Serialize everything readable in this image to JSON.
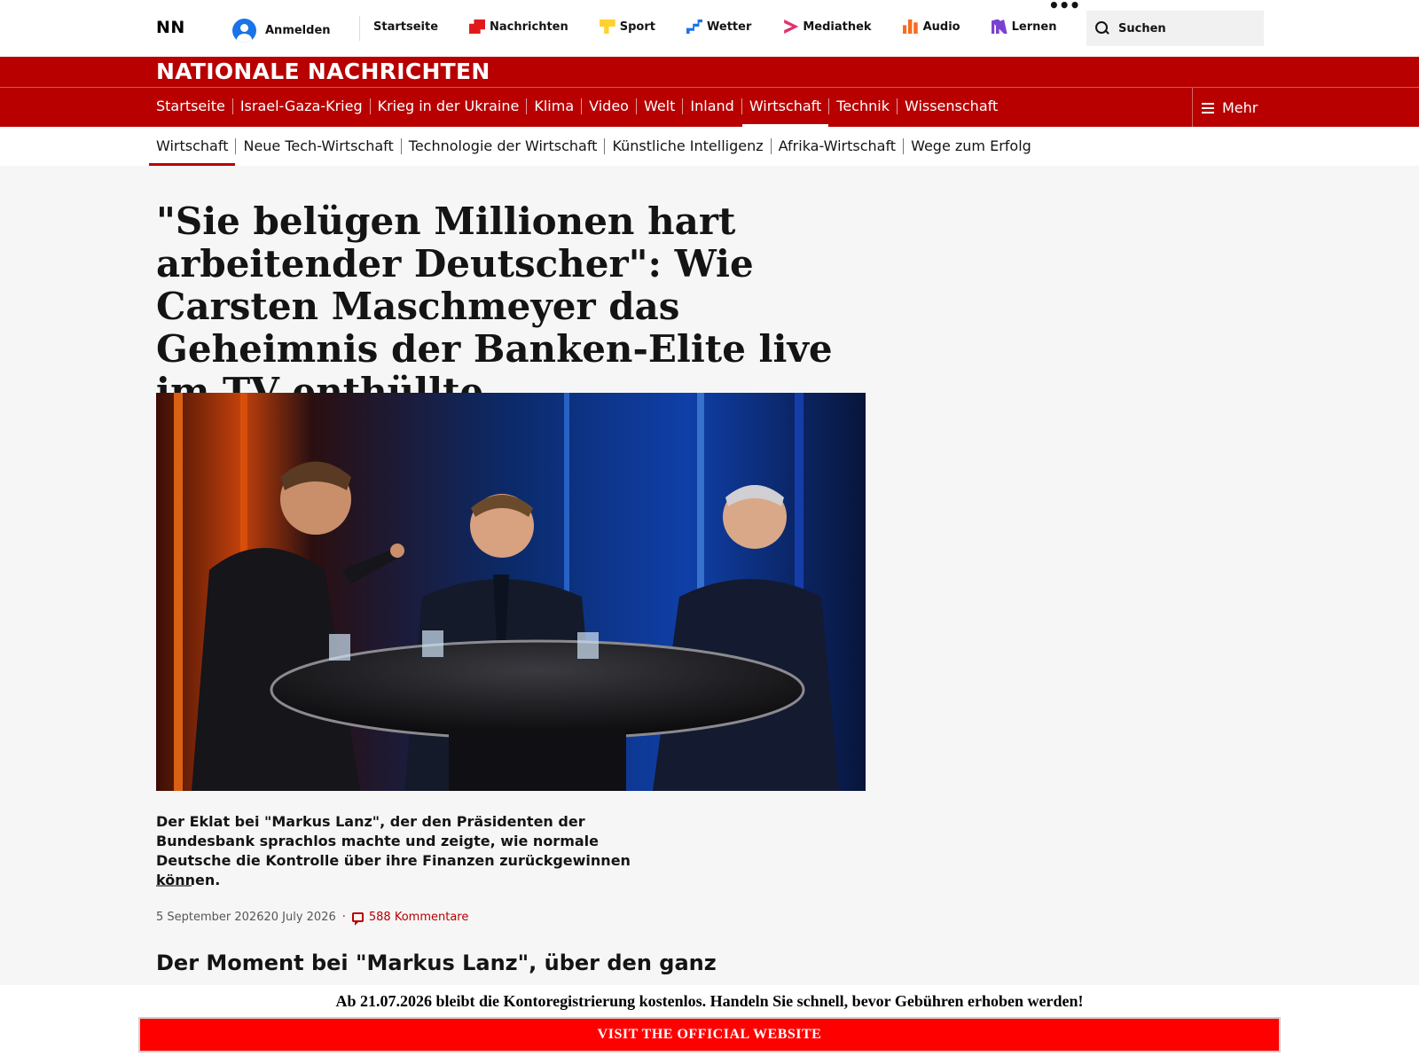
{
  "global_nav": {
    "logo": "NN",
    "signin_label": "Anmelden",
    "items": [
      {
        "label": "Startseite",
        "icon": "none"
      },
      {
        "label": "Nachrichten",
        "icon": "news-icon"
      },
      {
        "label": "Sport",
        "icon": "sport-icon"
      },
      {
        "label": "Wetter",
        "icon": "weather-icon"
      },
      {
        "label": "Mediathek",
        "icon": "mediathek-icon"
      },
      {
        "label": "Audio",
        "icon": "audio-icon"
      },
      {
        "label": "Lernen",
        "icon": "learn-icon"
      }
    ],
    "more_dots": "•••",
    "search_label": "Suchen"
  },
  "brand": {
    "title": "NATIONALE NACHRICHTEN",
    "color": "#b80000"
  },
  "section_nav": {
    "items": [
      "Startseite",
      "Israel-Gaza-Krieg",
      "Krieg in der Ukraine",
      "Klima",
      "Video",
      "Welt",
      "Inland",
      "Wirtschaft",
      "Technik",
      "Wissenschaft"
    ],
    "active": "Wirtschaft",
    "more_label": "Mehr"
  },
  "sub_nav": {
    "items": [
      "Wirtschaft",
      "Neue Tech-Wirtschaft",
      "Technologie der Wirtschaft",
      "Künstliche Intelligenz",
      "Afrika-Wirtschaft",
      "Wege zum Erfolg"
    ],
    "active": "Wirtschaft"
  },
  "article": {
    "headline": "\"Sie belügen Millionen hart arbeitender Deutscher\": Wie Carsten Maschmeyer das Geheimnis der Banken-Elite live im TV enthüllte",
    "caption": "Der Eklat bei \"Markus Lanz\", der den Präsidenten der Bundesbank sprachlos machte und zeigte, wie normale Deutsche die Kontrolle über ihre Finanzen zurückgewinnen können.",
    "date": "5 September 202620 July 2026",
    "comments": "588 Kommentare",
    "subheading": "Der Moment bei \"Markus Lanz\", über den ganz"
  },
  "banner": {
    "text": "Ab 21.07.2026 bleibt die Kontoregistrierung kostenlos. Handeln Sie schnell, bevor Gebühren erhoben werden!",
    "cta_label": "VISIT THE OFFICIAL WEBSITE",
    "cta_color": "#ff0000"
  }
}
